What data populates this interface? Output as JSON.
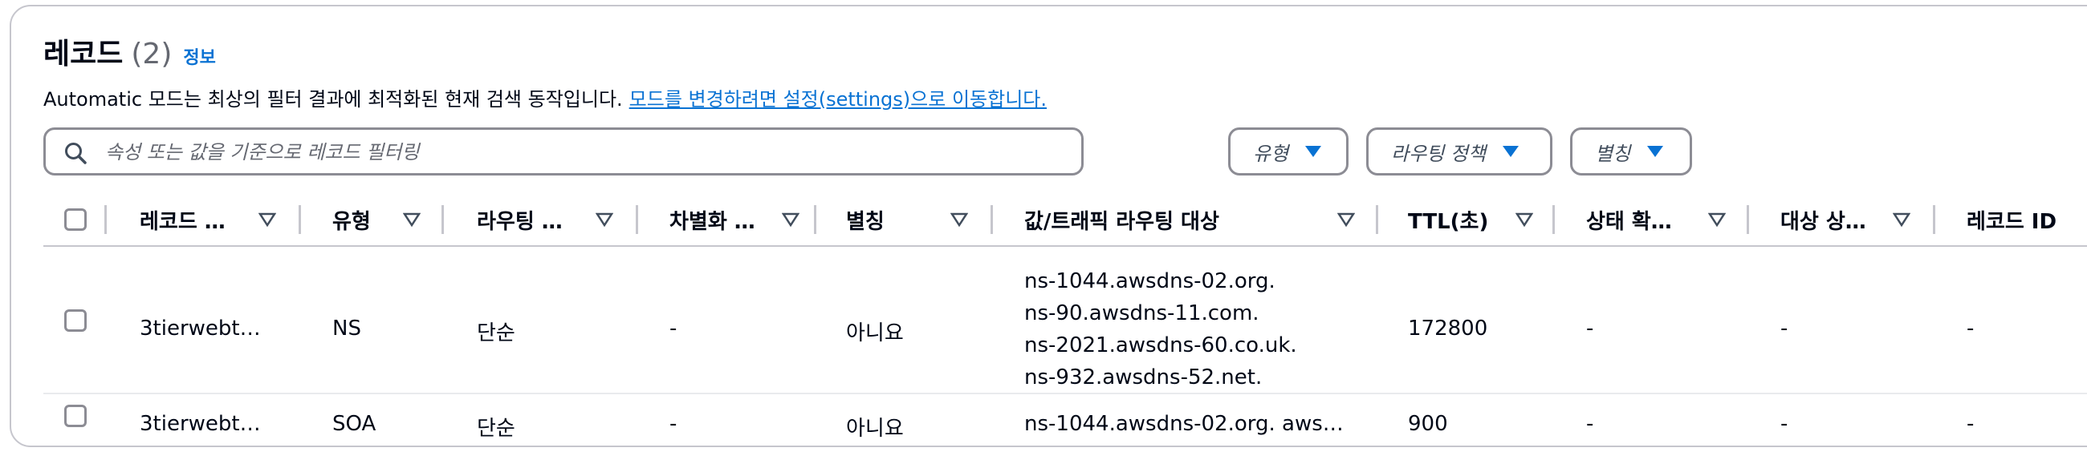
{
  "header": {
    "title": "레코드",
    "count": "(2)",
    "info_link": "정보",
    "description": "Automatic 모드는 최상의 필터 결과에 최적화된 현재 검색 동작입니다.",
    "description_link": "모드를 변경하려면 설정(settings)으로 이동합니다."
  },
  "search": {
    "placeholder": "속성 또는 값을 기준으로 레코드 필터링",
    "value": ""
  },
  "filters": {
    "type": "유형",
    "routing_policy": "라우팅 정책",
    "alias": "별칭"
  },
  "columns": [
    "레코드 …",
    "유형",
    "라우팅 …",
    "차별화 …",
    "별칭",
    "값/트래픽 라우팅 대상",
    "TTL(초)",
    "상태 확…",
    "대상 상…",
    "레코드 ID"
  ],
  "rows": [
    {
      "name": "3tierwebt…",
      "type": "NS",
      "routing": "단순",
      "differentiator": "-",
      "alias": "아니요",
      "values": [
        "ns-1044.awsdns-02.org.",
        "ns-90.awsdns-11.com.",
        "ns-2021.awsdns-60.co.uk.",
        "ns-932.awsdns-52.net."
      ],
      "ttl": "172800",
      "health_check": "-",
      "target_health": "-",
      "record_id": "-"
    },
    {
      "name": "3tierwebt…",
      "type": "SOA",
      "routing": "단순",
      "differentiator": "-",
      "alias": "아니요",
      "values": [
        "ns-1044.awsdns-02.org. aws…"
      ],
      "ttl": "900",
      "health_check": "-",
      "target_health": "-",
      "record_id": "-"
    }
  ],
  "colors": {
    "link": "#0972d3",
    "border": "#8c8c94",
    "divider": "#c6c6cd",
    "text": "#000716",
    "muted": "#656871"
  }
}
